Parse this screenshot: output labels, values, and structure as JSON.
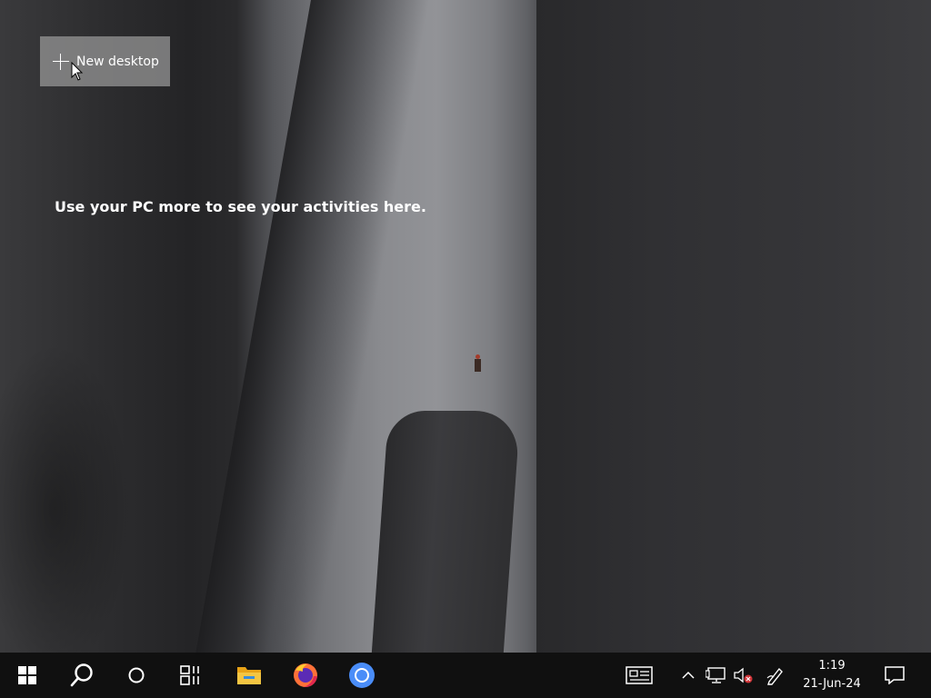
{
  "desktop": {
    "new_desktop_label": "New desktop",
    "activity_message": "Use your PC more to see your activities here."
  },
  "taskbar": {
    "items": [
      {
        "name": "start-button",
        "icon": "windows-logo-icon"
      },
      {
        "name": "search-button",
        "icon": "search-icon"
      },
      {
        "name": "cortana-button",
        "icon": "cortana-circle-icon"
      },
      {
        "name": "task-view-button",
        "icon": "task-view-icon"
      },
      {
        "name": "file-explorer-button",
        "icon": "folder-icon"
      },
      {
        "name": "firefox-button",
        "icon": "firefox-icon"
      },
      {
        "name": "chromium-button",
        "icon": "chromium-icon"
      }
    ],
    "tray": {
      "icons": [
        "news-widget-icon",
        "chevron-up-icon",
        "network-icon",
        "volume-muted-icon",
        "pen-icon"
      ],
      "time": "1:19",
      "date": "21-Jun-24",
      "notifications_icon": "action-center-icon"
    }
  },
  "colors": {
    "taskbar": "#101010",
    "new_desktop_bg": "#969696",
    "firefox_orange": "#ff7139",
    "chromium_blue": "#4a8df8",
    "folder_yellow": "#f4c542"
  }
}
